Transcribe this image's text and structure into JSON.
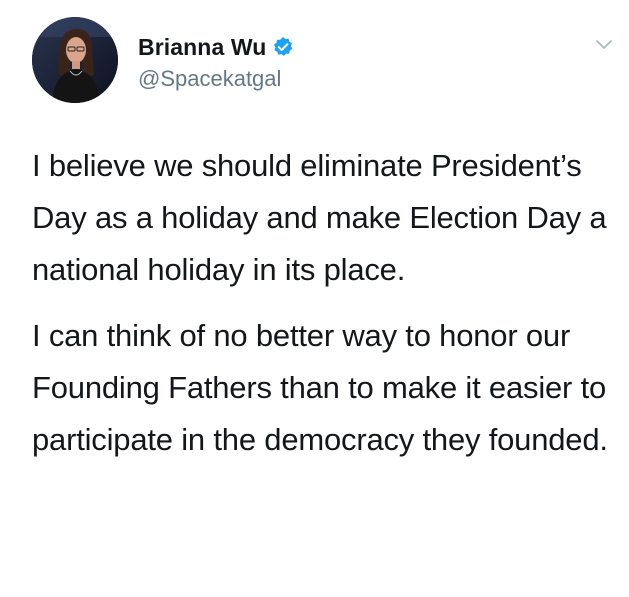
{
  "author": {
    "display_name": "Brianna Wu",
    "handle": "@Spacekatgal",
    "verified": true,
    "avatar_icon": "profile-photo",
    "verified_icon": "verified-badge-icon"
  },
  "tweet": {
    "paragraphs": [
      "I believe we should eliminate President’s Day as a holiday and make Election Day a national holiday in its place.",
      "I can think of no better way to honor our Founding Fathers than to make it easier to participate in the democracy they founded."
    ]
  },
  "menu": {
    "icon": "chevron-down-icon"
  },
  "colors": {
    "text": "#14171a",
    "handle": "#657786",
    "verified_blue": "#1da1f2",
    "background": "#ffffff"
  }
}
